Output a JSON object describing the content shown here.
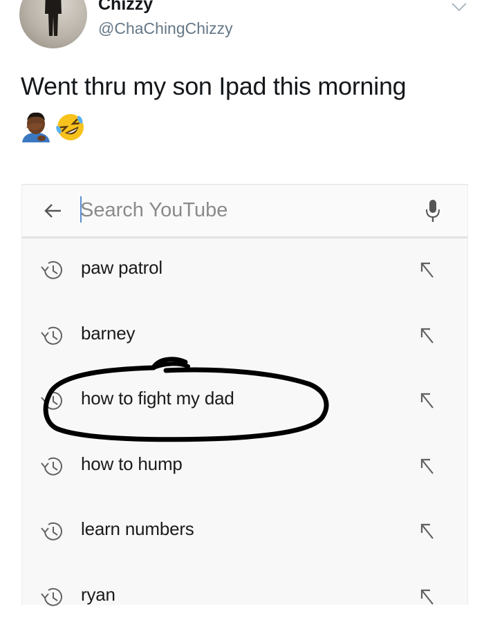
{
  "tweet": {
    "display_name": "Chizzy",
    "handle": "@ChaChingChizzy",
    "text": "Went thru my son Ipad this morning",
    "emoji": [
      "🤦🏾‍♂️",
      "🤣"
    ]
  },
  "search": {
    "placeholder": "Search YouTube",
    "value": ""
  },
  "suggestions": [
    {
      "label": "paw patrol"
    },
    {
      "label": "barney"
    },
    {
      "label": "how to fight my dad",
      "circled": true
    },
    {
      "label": "how to hump"
    },
    {
      "label": "learn numbers"
    },
    {
      "label": "ryan"
    }
  ],
  "colors": {
    "handle": "#657786",
    "panel_bg": "#f8f8f8",
    "icon": "#606060",
    "cursor": "#5a8ed0",
    "marker": "#000000"
  },
  "icons": {
    "back": "arrow-left-icon",
    "mic": "mic-icon",
    "history": "history-icon",
    "fill": "arrow-up-left-icon",
    "caret": "chevron-down-icon"
  }
}
